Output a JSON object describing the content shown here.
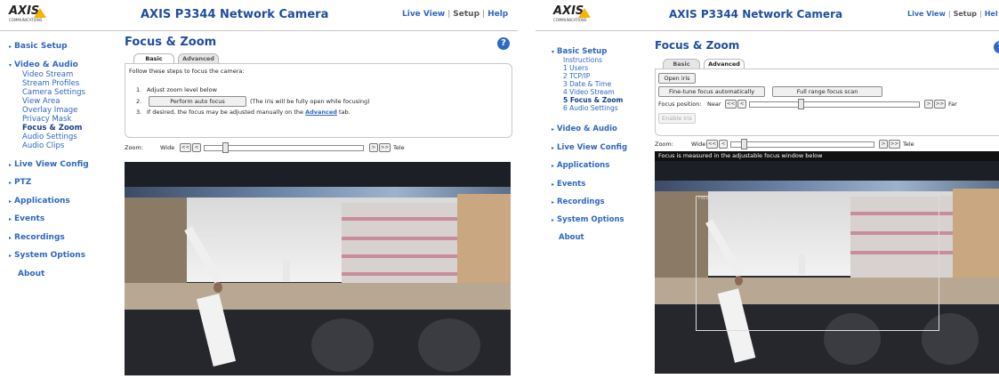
{
  "left": {
    "brand": {
      "logo": "AXIS",
      "tagline": "COMMUNICATIONS"
    },
    "title": "AXIS P3344 Network Camera",
    "links": {
      "live_view": "Live View",
      "sep1": "|",
      "setup": "Setup",
      "sep2": "|",
      "help": "Help"
    },
    "nav": [
      {
        "label": "Basic Setup"
      },
      {
        "label": "Video & Audio"
      },
      {
        "label": "Live View Config"
      },
      {
        "label": "PTZ"
      },
      {
        "label": "Applications"
      },
      {
        "label": "Events"
      },
      {
        "label": "Recordings"
      },
      {
        "label": "System Options"
      },
      {
        "label": "About"
      }
    ],
    "video_audio_items": [
      "Video Stream",
      "Stream Profiles",
      "Camera Settings",
      "View Area",
      "Overlay Image",
      "Privacy Mask",
      "Focus & Zoom",
      "Audio Settings",
      "Audio Clips"
    ],
    "page_title": "Focus & Zoom",
    "help_icon": "?",
    "tabs": {
      "basic": "Basic",
      "advanced": "Advanced"
    },
    "instructions": "Follow these steps to focus the camera:",
    "steps": {
      "n1": "1.",
      "s1": "Adjust zoom level below",
      "n2": "2.",
      "s2_button": "Perform auto focus",
      "s2_note": "(The iris will be fully open while focusing)",
      "n3": "3.",
      "s3_pre": "If desired, the focus may be adjusted manually on the",
      "s3_link": "Advanced",
      "s3_post": "tab."
    },
    "zoom": {
      "label": "Zoom:",
      "wide": "Wide",
      "tele": "Tele",
      "ll": "<<",
      "l": "<",
      "r": ">",
      "rr": ">>",
      "level": 0.12
    }
  },
  "right": {
    "brand": {
      "logo": "AXIS",
      "tagline": "COMMUNICATIONS"
    },
    "title": "AXIS P3344 Network Camera",
    "links": {
      "live_view": "Live View",
      "sep1": "|",
      "setup": "Setup",
      "sep2": "|",
      "help": "Hel"
    },
    "nav": [
      {
        "label": "Basic Setup"
      },
      {
        "label": "Video & Audio"
      },
      {
        "label": "Live View Config"
      },
      {
        "label": "Applications"
      },
      {
        "label": "Events"
      },
      {
        "label": "Recordings"
      },
      {
        "label": "System Options"
      },
      {
        "label": "About"
      }
    ],
    "basic_setup_items": [
      "Instructions",
      "1 Users",
      "2 TCP/IP",
      "3 Date & Time",
      "4 Video Stream",
      "5 Focus & Zoom",
      "6 Audio Settings"
    ],
    "page_title": "Focus & Zoom",
    "tabs": {
      "basic": "Basic",
      "advanced": "Advanced"
    },
    "open_iris": "Open iris",
    "fine_tune": "Fine-tune focus automatically",
    "full_range": "Full range focus scan",
    "focus": {
      "label": "Focus position:",
      "near": "Near",
      "far": "Far",
      "ll": "<<",
      "l": "<",
      "r": ">",
      "rr": ">>",
      "level": 0.3
    },
    "enable_iris": "Enable iris",
    "zoom": {
      "label": "Zoom:",
      "wide": "Wide",
      "tele": "Tele",
      "ll": "<<",
      "l": "<",
      "r": ">",
      "rr": ">>",
      "level": 0.08
    },
    "overlay_text": "Focus is measured in the adjustable focus window below",
    "focus_window_label": "Focus window"
  },
  "colors": {
    "link": "#2e68c0",
    "title": "#1f4e9e",
    "logo_accent": "#f4b400"
  },
  "icons": {
    "help": "help-icon",
    "nav_arrow": "arrow-right-icon",
    "nav_expanded": "arrow-down-icon"
  }
}
